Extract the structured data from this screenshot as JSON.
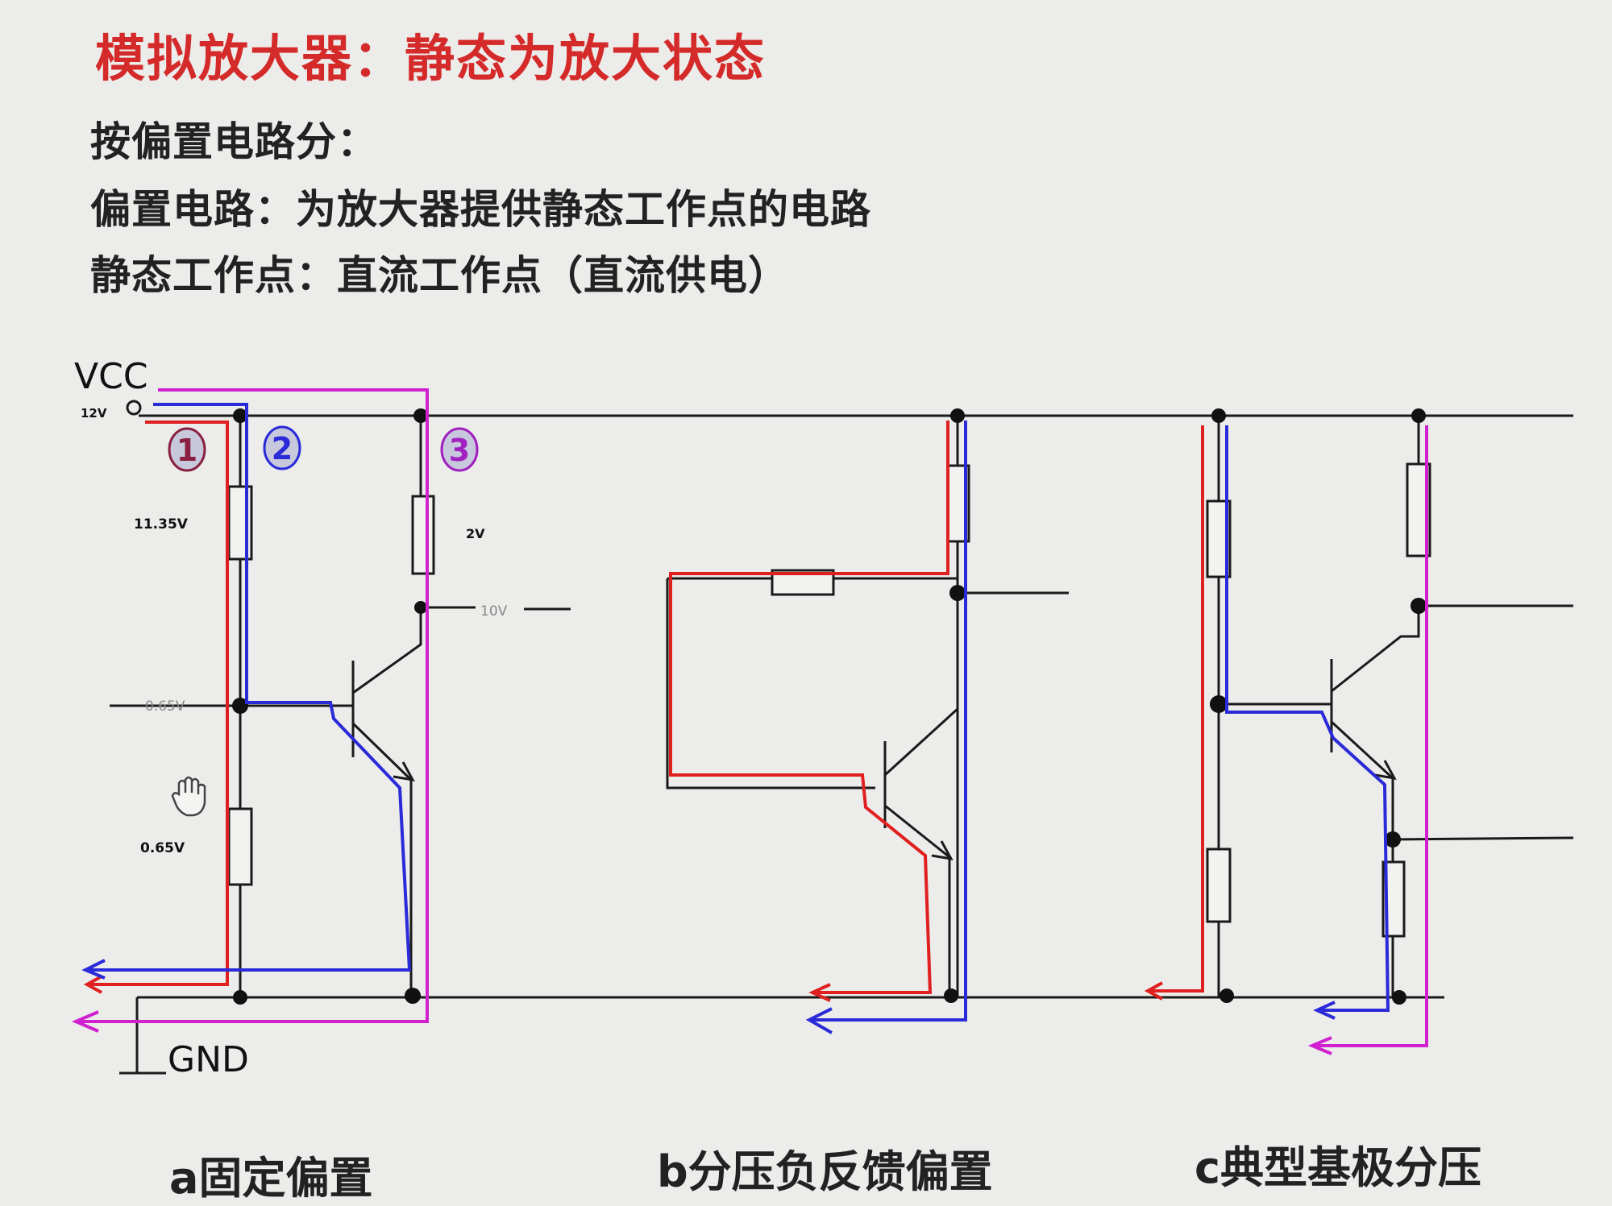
{
  "title": "模拟放大器：静态为放大状态",
  "lines": [
    "按偏置电路分：",
    "偏置电路：为放大器提供静态工作点的电路",
    "静态工作点：直流工作点（直流供电）"
  ],
  "labels": {
    "vcc": "VCC",
    "v12": "12V",
    "gnd": "GND",
    "v1135": "11.35V",
    "v065_base": "0.65V",
    "v065_lower": "0.65V",
    "v2": "2V",
    "v10": "10V",
    "path1": "1",
    "path2": "2",
    "path3": "3"
  },
  "captions": {
    "a": "a固定偏置",
    "b": "b分压负反馈偏置",
    "c": "c典型基极分压"
  },
  "colors": {
    "title": "#d42a2a",
    "wire": "#1a1a1a",
    "path_red": "#e02020",
    "path_blue": "#2a2ad8",
    "path_magenta": "#d020d0",
    "background": "#ececea"
  }
}
